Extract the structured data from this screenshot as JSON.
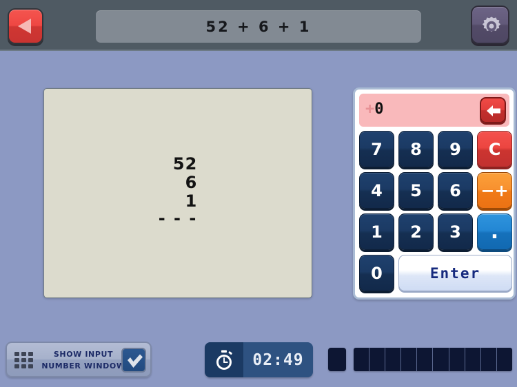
{
  "header": {
    "back_icon": "triangle-left-icon",
    "problem_title": "52 + 6 + 1",
    "settings_icon": "gear-icon"
  },
  "worksheet": {
    "addends": [
      "52",
      "6",
      "1"
    ],
    "rule": "- - -"
  },
  "keypad": {
    "display": {
      "sign": "+",
      "value": "0"
    },
    "backspace_icon": "arrow-left-icon",
    "keys": [
      {
        "label": "7",
        "name": "key-7",
        "style": "num"
      },
      {
        "label": "8",
        "name": "key-8",
        "style": "num"
      },
      {
        "label": "9",
        "name": "key-9",
        "style": "num"
      },
      {
        "label": "C",
        "name": "key-clear",
        "style": "red"
      },
      {
        "label": "4",
        "name": "key-4",
        "style": "num"
      },
      {
        "label": "5",
        "name": "key-5",
        "style": "num"
      },
      {
        "label": "6",
        "name": "key-6",
        "style": "num"
      },
      {
        "label": "−+",
        "name": "key-sign-toggle",
        "style": "orange"
      },
      {
        "label": "1",
        "name": "key-1",
        "style": "num"
      },
      {
        "label": "2",
        "name": "key-2",
        "style": "num"
      },
      {
        "label": "3",
        "name": "key-3",
        "style": "num"
      },
      {
        "label": ".",
        "name": "key-decimal",
        "style": "blue"
      },
      {
        "label": "0",
        "name": "key-0",
        "style": "num"
      },
      {
        "label": "Enter",
        "name": "key-enter",
        "style": "enter"
      }
    ]
  },
  "footer": {
    "show_input": {
      "grid_icon": "grid-3x3-icon",
      "label_line1": "SHOW INPUT",
      "label_line2": "NUMBER WINDOW",
      "checked": true,
      "check_icon": "check-icon"
    },
    "timer": {
      "icon": "stopwatch-icon",
      "value": "02:49"
    },
    "progress": {
      "segments": 10,
      "filled": 0
    }
  },
  "colors": {
    "page_bg": "#8c99c3",
    "header_bg": "#4f5a63",
    "worksheet_bg": "#dcdbcd",
    "key_num": "#1b3a64",
    "key_clear": "#ec4540",
    "key_sign": "#f8912f",
    "key_decimal": "#2387d4",
    "display_bg": "#f9b9bb",
    "timer_bg": "#2e5281"
  }
}
